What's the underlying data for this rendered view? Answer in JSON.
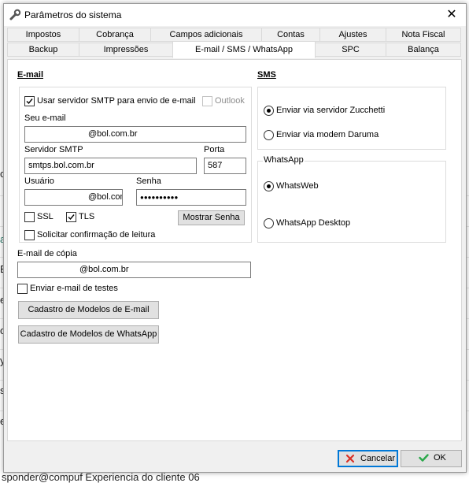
{
  "window": {
    "title": "Parâmetros do sistema",
    "close_label": "✕"
  },
  "tabs": {
    "row1": [
      "Impostos",
      "Cobrança",
      "Campos adicionais",
      "Contas",
      "Ajustes",
      "Nota Fiscal"
    ],
    "row2": [
      "Backup",
      "Impressões",
      "E-mail / SMS / WhatsApp",
      "SPC",
      "Balança"
    ]
  },
  "email": {
    "section_title": "E-mail",
    "use_smtp_label": "Usar servidor SMTP para envio de e-mail",
    "use_smtp_checked": true,
    "outlook_label": "Outlook",
    "outlook_checked": false,
    "your_email_label": "Seu e-mail",
    "your_email_value": "@bol.com.br",
    "smtp_server_label": "Servidor SMTP",
    "smtp_server_value": "smtps.bol.com.br",
    "port_label": "Porta",
    "port_value": "587",
    "user_label": "Usuário",
    "user_value": "@bol.com",
    "password_label": "Senha",
    "password_value": "●●●●●●●●●●",
    "ssl_label": "SSL",
    "ssl_checked": false,
    "tls_label": "TLS",
    "tls_checked": true,
    "show_password_label": "Mostrar Senha",
    "read_receipt_label": "Solicitar confirmação de leitura",
    "read_receipt_checked": false,
    "copy_email_label": "E-mail de cópia",
    "copy_email_value": "@bol.com.br",
    "send_test_label": "Enviar e-mail de testes",
    "send_test_checked": false,
    "email_templates_button": "Cadastro de Modelos de E-mail",
    "whatsapp_templates_button": "Cadastro de Modelos de WhatsApp"
  },
  "sms": {
    "section_title": "SMS",
    "option_zucchetti": "Enviar via servidor Zucchetti",
    "option_daruma": "Enviar via modem Daruma",
    "selected": "zucchetti"
  },
  "whatsapp": {
    "group_title": "WhatsApp",
    "option_web": "WhatsWeb",
    "option_desktop": "WhatsApp Desktop",
    "selected": "web"
  },
  "footer": {
    "cancel_label": "Cancelar",
    "ok_label": "OK"
  },
  "background": {
    "bottom_text": "sponder@compuf     Experiencia do cliente 06",
    "left_fragments": [
      "c",
      "a",
      "E",
      "e",
      "o",
      "y",
      "s",
      "e"
    ]
  },
  "colors": {
    "focus_border": "#0078d7",
    "cancel_icon": "#d93025",
    "ok_icon": "#2aa84a"
  }
}
